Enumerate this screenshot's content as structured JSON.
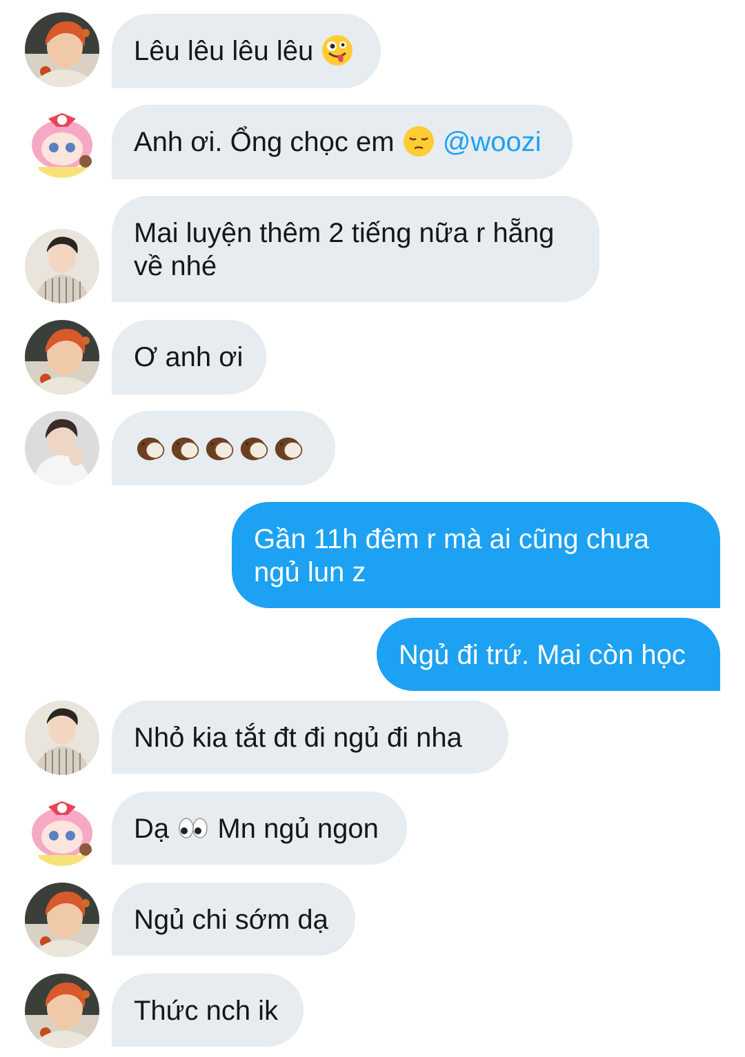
{
  "messages": [
    {
      "sender": "avatar-red-hair",
      "direction": "in",
      "text": "Lêu lêu lêu lêu",
      "emoji": "zany-face"
    },
    {
      "sender": "avatar-pink-anime",
      "direction": "in",
      "text": "Anh ơi. Ổng chọc em",
      "emoji": "pensive-face",
      "mention": "@woozi"
    },
    {
      "sender": "avatar-striped-shirt",
      "direction": "in",
      "lines": [
        "Mai luyện thêm 2 tiếng nữa r hẵng",
        "về nhé"
      ]
    },
    {
      "sender": "avatar-red-hair",
      "direction": "in",
      "text": "Ơ anh ơi"
    },
    {
      "sender": "avatar-white-shirt",
      "direction": "in",
      "emoji": "coconut",
      "emoji_count": 5
    },
    {
      "direction": "out",
      "lines": [
        "Gần 11h đêm r mà ai cũng chưa",
        "ngủ lun z"
      ]
    },
    {
      "direction": "out",
      "text": "Ngủ đi trứ. Mai còn học"
    },
    {
      "sender": "avatar-striped-shirt",
      "direction": "in",
      "text": "Nhỏ kia tắt đt đi ngủ đi nha"
    },
    {
      "sender": "avatar-pink-anime",
      "direction": "in",
      "text_before": "Dạ",
      "emoji": "eyes",
      "text_after": "Mn ngủ ngon"
    },
    {
      "sender": "avatar-red-hair",
      "direction": "in",
      "text": "Ngủ chi sớm dạ"
    },
    {
      "sender": "avatar-red-hair",
      "direction": "in",
      "text": "Thức nch ik"
    }
  ],
  "colors": {
    "incoming_bubble": "#e6ecf0",
    "outgoing_bubble": "#1da1f2",
    "text": "#14171a",
    "mention": "#1da1f2"
  }
}
